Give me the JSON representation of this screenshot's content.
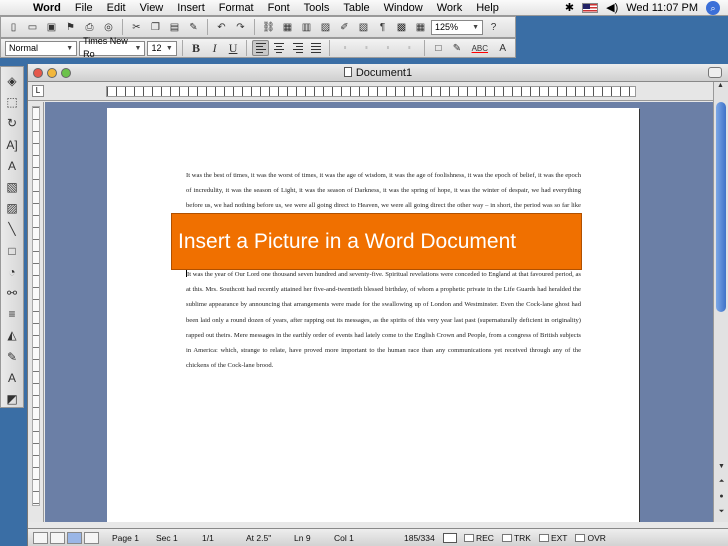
{
  "menubar": {
    "app": "Word",
    "items": [
      "File",
      "Edit",
      "View",
      "Insert",
      "Format",
      "Font",
      "Tools",
      "Table",
      "Window",
      "Work",
      "Help"
    ],
    "clock": "Wed 11:07 PM"
  },
  "toolbar": {
    "zoom": "125%",
    "style": "Normal",
    "font": "Times New Ro",
    "size": "12",
    "bold": "B",
    "italic": "I",
    "underline": "U",
    "spelling": "ABC"
  },
  "window": {
    "title": "Document1"
  },
  "document": {
    "paragraph1": "It was the best of times, it was the worst of times, it was the age of wisdom, it was the age of foolishness, it was the epoch of belief, it was the epoch of incredulity, it was the season of Light, it was the season of Darkness, it was the spring of hope, it was the winter of despair, we had everything before us, we had nothing before us, we were all going direct to Heaven, we were all going direct the other way – in short, the period was so far like the present period, that some of its noisiest authorities insisted on its being received, for good or for evil, in the superlative degree of comparison only.",
    "paragraph2": "It was the year of Our Lord one thousand seven hundred and seventy-five. Spiritual revelations were conceded to England at that favoured period, as at this. Mrs. Southcott had recently attained her five-and-twentieth blessed birthday, of whom a prophetic private in the Life Guards had heralded the sublime appearance by announcing that arrangements were made for the swallowing up of London and Westminster. Even the Cock-lane ghost had been laid only a round dozen of years, after rapping out its messages, as the spirits of this very year last past (supernaturally deficient in originality) rapped out theirs. Mere messages in the earthly order of events had lately come to the English Crown and People, from a congress of British subjects in America: which, strange to relate, have proved more important to the human race than any communications yet received through any of the chickens of the Cock-lane brood."
  },
  "banner": {
    "text": "Insert a Picture in a Word Document"
  },
  "status": {
    "page": "Page 1",
    "section": "Sec 1",
    "pages": "1/1",
    "at": "At 2.5\"",
    "line": "Ln 9",
    "col": "Col 1",
    "words": "185/334",
    "rec": "REC",
    "trk": "TRK",
    "ext": "EXT",
    "ovr": "OVR"
  },
  "colors": {
    "banner": "#f07000",
    "desktop": "#3a6ea5",
    "docarea": "#6b7fa6"
  }
}
